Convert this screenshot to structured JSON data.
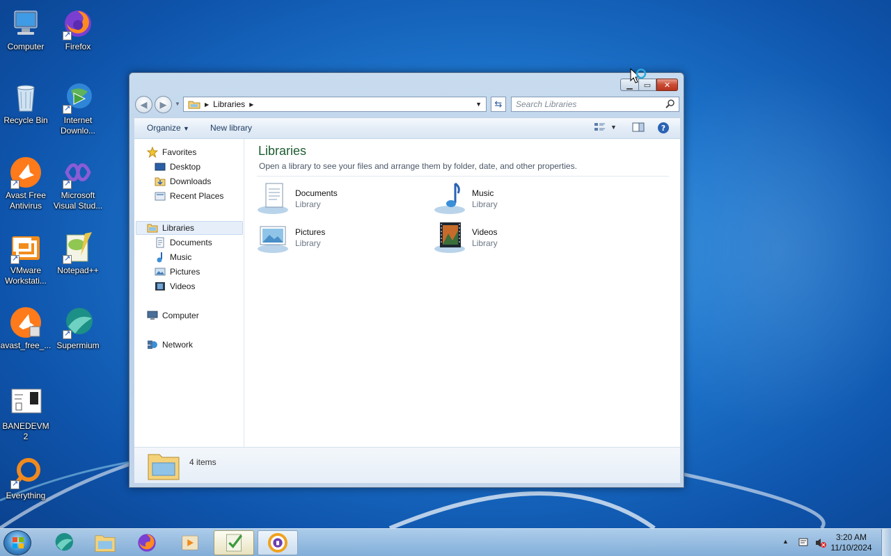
{
  "desktop": {
    "icons": [
      {
        "id": "computer",
        "label": "Computer",
        "icon": "computer-icon"
      },
      {
        "id": "firefox",
        "label": "Firefox",
        "icon": "firefox-icon"
      },
      {
        "id": "recycle",
        "label": "Recycle Bin",
        "icon": "recycle-bin-icon"
      },
      {
        "id": "idm",
        "label": "Internet Downlo...",
        "icon": "internet-download-manager-icon"
      },
      {
        "id": "avast",
        "label": "Avast Free Antivirus",
        "icon": "avast-icon"
      },
      {
        "id": "vs",
        "label": "Microsoft Visual Stud...",
        "icon": "visual-studio-icon"
      },
      {
        "id": "vmware",
        "label": "VMware Workstati...",
        "icon": "vmware-icon"
      },
      {
        "id": "notepadpp",
        "label": "Notepad++",
        "icon": "notepad-plus-plus-icon"
      },
      {
        "id": "avastsetup",
        "label": "avast_free_...",
        "icon": "avast-setup-icon"
      },
      {
        "id": "supermium",
        "label": "Supermium",
        "icon": "supermium-icon"
      },
      {
        "id": "banedevm",
        "label": "BANEDEVM 2",
        "icon": "document-icon"
      },
      {
        "id": "everything",
        "label": "Everything",
        "icon": "everything-search-icon"
      }
    ]
  },
  "explorer": {
    "address": {
      "crumb": "Libraries"
    },
    "search": {
      "placeholder": "Search Libraries"
    },
    "toolbar": {
      "organize": "Organize",
      "new_library": "New library"
    },
    "nav": {
      "favorites": "Favorites",
      "desktop": "Desktop",
      "downloads": "Downloads",
      "recent": "Recent Places",
      "libraries": "Libraries",
      "documents": "Documents",
      "music": "Music",
      "pictures": "Pictures",
      "videos": "Videos",
      "computer": "Computer",
      "network": "Network"
    },
    "main": {
      "title": "Libraries",
      "description": "Open a library to see your files and arrange them by folder, date, and other properties.",
      "items": [
        {
          "name": "Documents",
          "sub": "Library"
        },
        {
          "name": "Music",
          "sub": "Library"
        },
        {
          "name": "Pictures",
          "sub": "Library"
        },
        {
          "name": "Videos",
          "sub": "Library"
        }
      ]
    },
    "details": {
      "count": "4 items"
    }
  },
  "taskbar": {
    "clock_time": "3:20 AM",
    "clock_date": "11/10/2024"
  },
  "colors": {
    "accent": "#1e5c32",
    "selection": "#e5eef9",
    "close": "#c94a33"
  }
}
